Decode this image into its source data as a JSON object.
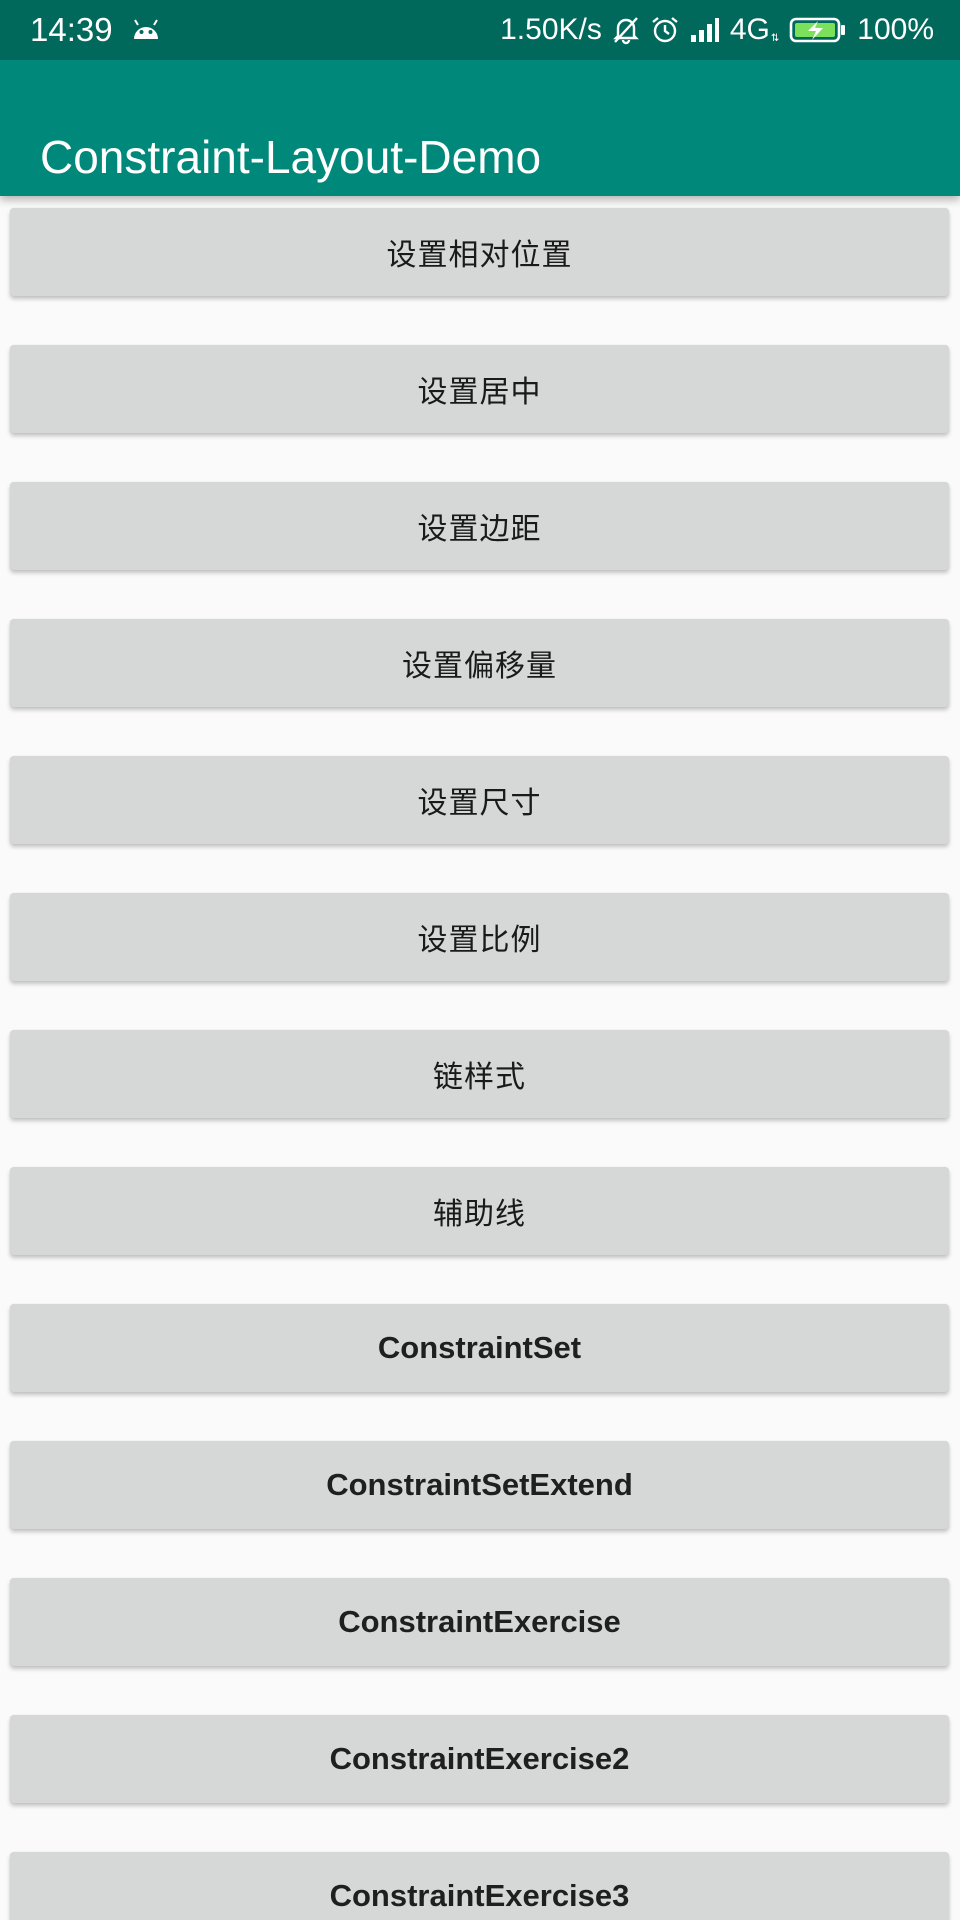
{
  "status_bar": {
    "time": "14:39",
    "net_speed": "1.50K/s",
    "network_type": "4G",
    "network_arrows": "⇅",
    "battery": "100%",
    "icons": [
      "android-icon",
      "muted-bell-icon",
      "alarm-icon",
      "signal-icon",
      "battery-charging-icon"
    ]
  },
  "app_bar": {
    "title": "Constraint-Layout-Demo",
    "color": "#00897b",
    "status_color": "#00695c"
  },
  "buttons": [
    {
      "label": "设置相对位置"
    },
    {
      "label": "设置居中"
    },
    {
      "label": "设置边距"
    },
    {
      "label": "设置偏移量"
    },
    {
      "label": "设置尺寸"
    },
    {
      "label": "设置比例"
    },
    {
      "label": "链样式"
    },
    {
      "label": "辅助线"
    },
    {
      "label": "ConstraintSet"
    },
    {
      "label": "ConstraintSetExtend"
    },
    {
      "label": "ConstraintExercise"
    },
    {
      "label": "ConstraintExercise2"
    },
    {
      "label": "ConstraintExercise3"
    }
  ]
}
